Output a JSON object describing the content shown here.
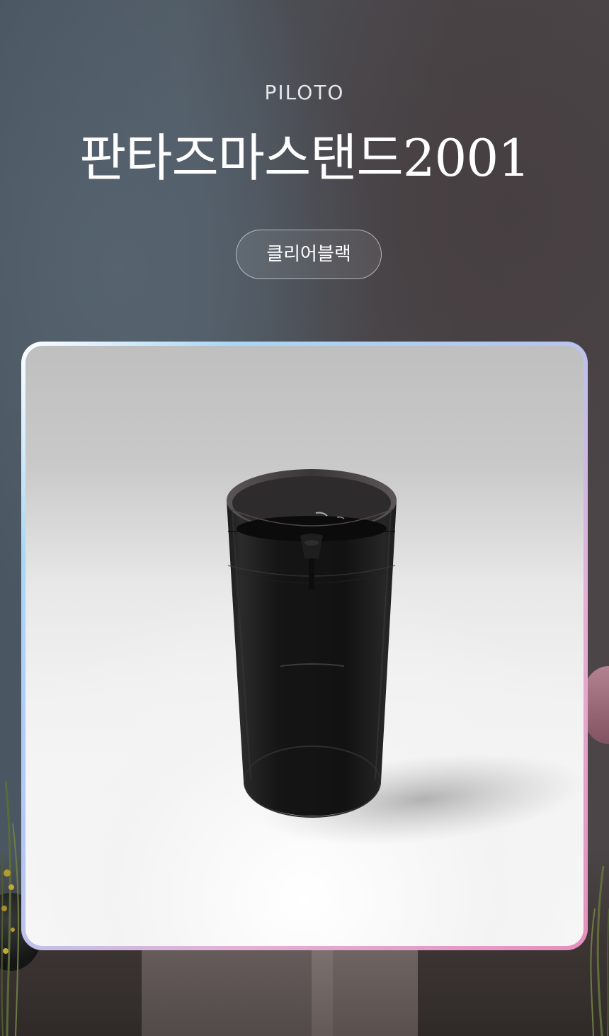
{
  "header": {
    "brand": "PILOTO",
    "title": "판타즈마스탠드2001"
  },
  "color_option": {
    "label": "클리어블랙"
  },
  "colors": {
    "frame_gradient": [
      "#ffffff",
      "#a9d7f5",
      "#e58fbd"
    ],
    "product_body": "#141414"
  },
  "product_image": {
    "icon": "cylinder-stand-image"
  }
}
